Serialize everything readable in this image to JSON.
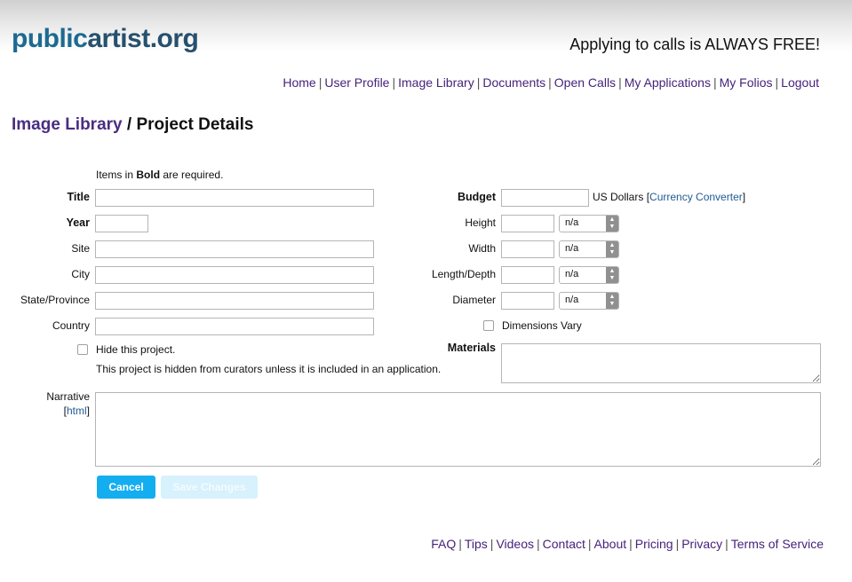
{
  "header": {
    "logo_part1": "public",
    "logo_part2": "artist.org",
    "tagline": "Applying to calls is ALWAYS FREE!"
  },
  "topnav": [
    "Home",
    "User Profile",
    "Image Library",
    "Documents",
    "Open Calls",
    "My Applications",
    "My Folios",
    "Logout"
  ],
  "page": {
    "crumb": "Image Library",
    "separator": " / ",
    "title": "Project Details"
  },
  "form": {
    "note_prefix": "Items in ",
    "note_bold": "Bold",
    "note_suffix": " are required.",
    "title_label": "Title",
    "year_label": "Year",
    "site_label": "Site",
    "city_label": "City",
    "state_label": "State/Province",
    "country_label": "Country",
    "hide_label": "Hide this project.",
    "hide_note": "This project is hidden from curators unless it is included in an application.",
    "narrative_label": "Narrative",
    "html_link": "html",
    "budget_label": "Budget",
    "budget_unit": "US Dollars",
    "currency_link": "Currency Converter",
    "height_label": "Height",
    "width_label": "Width",
    "length_label": "Length/Depth",
    "diameter_label": "Diameter",
    "unit_value": "n/a",
    "dims_vary_label": "Dimensions Vary",
    "materials_label": "Materials",
    "values": {
      "title": "",
      "year": "",
      "site": "",
      "city": "",
      "state": "",
      "country": "",
      "budget": "",
      "height": "",
      "width": "",
      "length": "",
      "diameter": ""
    },
    "hide_checked": false,
    "dims_vary_checked": false
  },
  "buttons": {
    "cancel": "Cancel",
    "save": "Save Changes"
  },
  "footer": [
    "FAQ",
    "Tips",
    "Videos",
    "Contact",
    "About",
    "Pricing",
    "Privacy",
    "Terms of Service"
  ],
  "colors": {
    "logo_public": "#1c6a91",
    "logo_artist": "#26506e",
    "nav_link": "#46227a",
    "crumb": "#4a2d82",
    "primary_button": "#14aef0",
    "disabled_button": "#d7f1fd"
  }
}
